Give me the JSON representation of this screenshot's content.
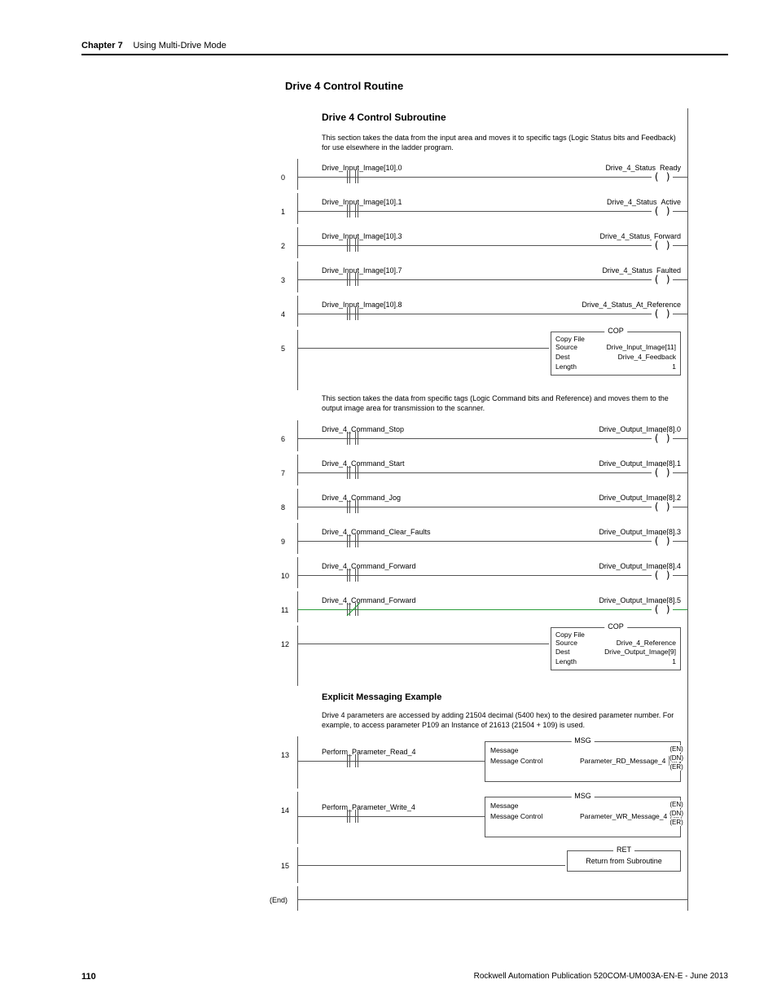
{
  "header": {
    "chapter": "Chapter 7",
    "title": "Using Multi-Drive Mode"
  },
  "section_title": "Drive 4 Control Routine",
  "subtitle": "Drive 4 Control Subroutine",
  "desc1": "This section takes the data from the input area and moves it to specific tags (Logic Status bits and Feedback) for use elsewhere in the ladder program.",
  "desc2": "This section takes the data from specific tags (Logic Command bits and Reference) and moves them to the output image area for transmission to the scanner.",
  "desc3": "Drive 4 parameters are accessed by adding 21504 decimal (5400 hex) to the desired parameter number. For example, to access parameter P109 an Instance of 21613 (21504 + 109) is used.",
  "explicit_title": "Explicit Messaging Example",
  "rungs": [
    {
      "n": "0",
      "left": "Drive_Input_Image[10].0",
      "right": "Drive_4_Status_Ready"
    },
    {
      "n": "1",
      "left": "Drive_Input_Image[10].1",
      "right": "Drive_4_Status_Active"
    },
    {
      "n": "2",
      "left": "Drive_Input_Image[10].3",
      "right": "Drive_4_Status_Forward"
    },
    {
      "n": "3",
      "left": "Drive_Input_Image[10].7",
      "right": "Drive_4_Status_Faulted"
    },
    {
      "n": "4",
      "left": "Drive_Input_Image[10].8",
      "right": "Drive_4_Status_At_Reference"
    }
  ],
  "cop1": {
    "n": "5",
    "title": "COP",
    "name": "Copy File",
    "rows": [
      {
        "k": "Source",
        "v": "Drive_Input_Image[11]"
      },
      {
        "k": "Dest",
        "v": "Drive_4_Feedback"
      },
      {
        "k": "Length",
        "v": "1"
      }
    ]
  },
  "rungs2": [
    {
      "n": "6",
      "left": "Drive_4_Command_Stop",
      "right": "Drive_Output_Image[8].0"
    },
    {
      "n": "7",
      "left": "Drive_4_Command_Start",
      "right": "Drive_Output_Image[8].1"
    },
    {
      "n": "8",
      "left": "Drive_4_Command_Jog",
      "right": "Drive_Output_Image[8].2"
    },
    {
      "n": "9",
      "left": "Drive_4_Command_Clear_Faults",
      "right": "Drive_Output_Image[8].3"
    },
    {
      "n": "10",
      "left": "Drive_4_Command_Forward",
      "right": "Drive_Output_Image[8].4"
    },
    {
      "n": "11",
      "left": "Drive_4_Command_Forward",
      "right": "Drive_Output_Image[8].5",
      "neg": true
    }
  ],
  "cop2": {
    "n": "12",
    "title": "COP",
    "name": "Copy File",
    "rows": [
      {
        "k": "Source",
        "v": "Drive_4_Reference"
      },
      {
        "k": "Dest",
        "v": "Drive_Output_Image[9]"
      },
      {
        "k": "Length",
        "v": "1"
      }
    ]
  },
  "msgs": [
    {
      "n": "13",
      "left": "Perform_Parameter_Read_4",
      "title": "MSG",
      "p1": "Message",
      "p2": "Message Control",
      "v": "Parameter_RD_Message_4"
    },
    {
      "n": "14",
      "left": "Perform_Parameter_Write_4",
      "title": "MSG",
      "p1": "Message",
      "p2": "Message Control",
      "v": "Parameter_WR_Message_4"
    }
  ],
  "ret": {
    "n": "15",
    "title": "RET",
    "label": "Return from Subroutine"
  },
  "end": "(End)",
  "msg_flags": {
    "en": "EN",
    "dn": "DN",
    "er": "ER"
  },
  "footer": {
    "page": "110",
    "pub": "Rockwell Automation Publication 520COM-UM003A-EN-E - June 2013"
  }
}
